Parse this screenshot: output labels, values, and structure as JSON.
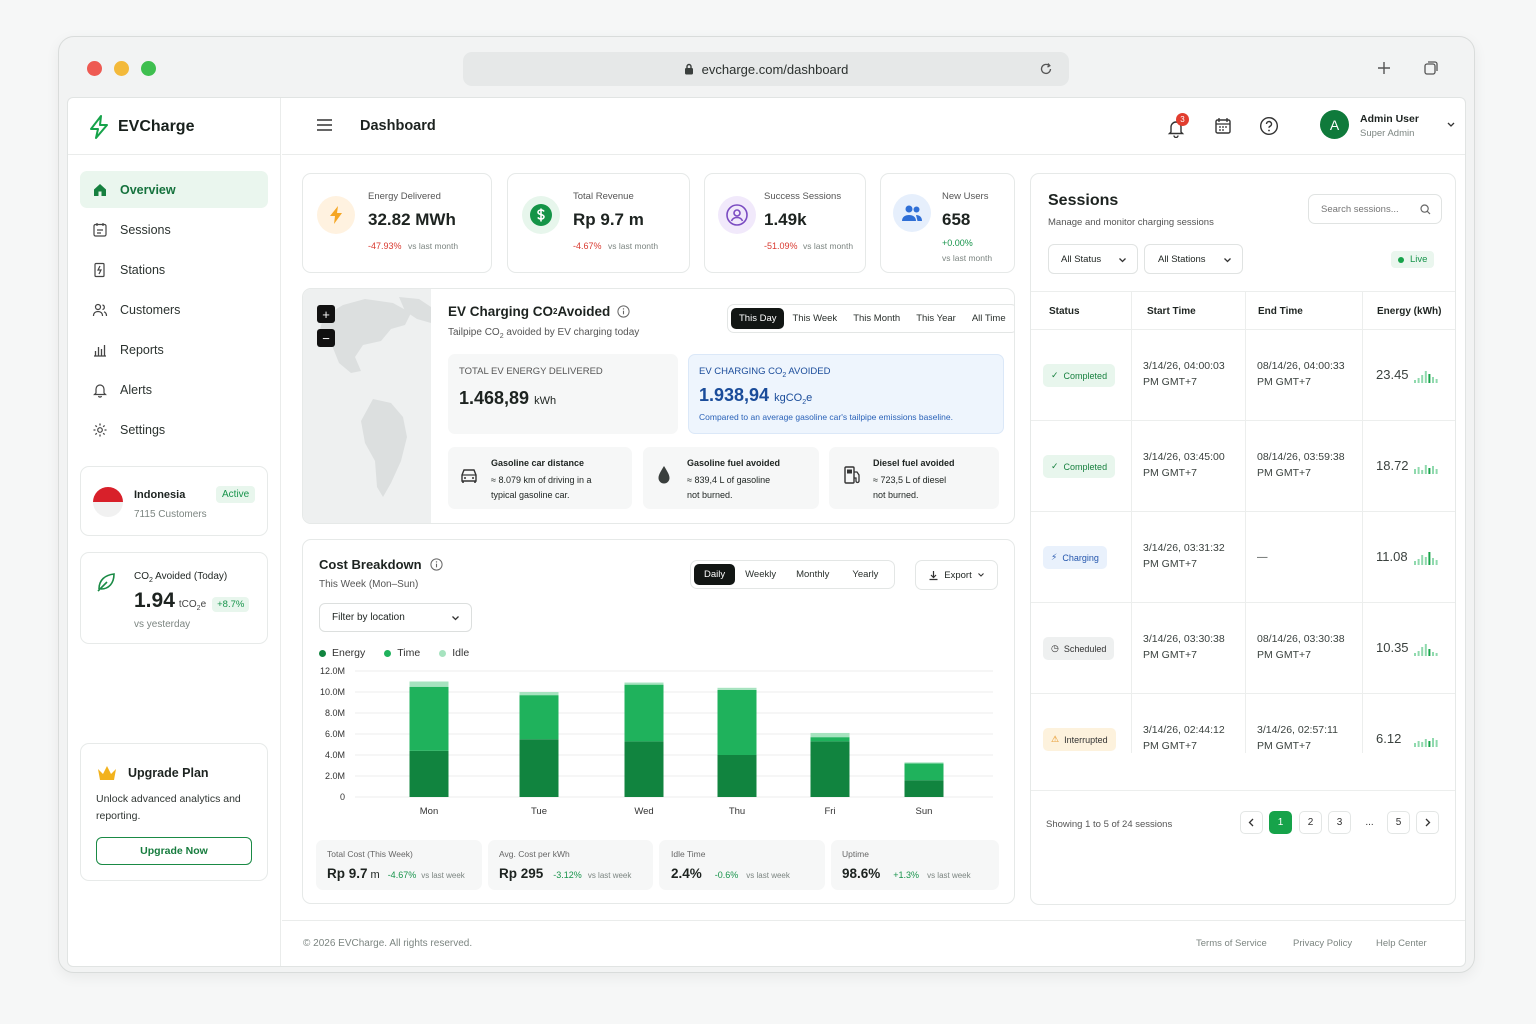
{
  "browser": {
    "url": "evcharge.com/dashboard"
  },
  "brand": {
    "name": "EVCharge"
  },
  "sidebar": {
    "items": [
      {
        "label": "Overview"
      },
      {
        "label": "Sessions"
      },
      {
        "label": "Stations"
      },
      {
        "label": "Customers"
      },
      {
        "label": "Reports"
      },
      {
        "label": "Alerts"
      },
      {
        "label": "Settings"
      }
    ],
    "region": {
      "name": "Indonesia",
      "status": "Active",
      "customers": "7115 Customers"
    },
    "co2": {
      "label_prefix": "CO",
      "label_sub": "2",
      "label_suffix": " Avoided (Today)",
      "value": "1.94",
      "unit": "tCO",
      "unit_sub": "2",
      "unit_suffix": "e",
      "change": "+8.7%",
      "compare": "vs yesterday"
    },
    "upgrade": {
      "title": "Upgrade Plan",
      "desc": "Unlock advanced analytics and reporting.",
      "button": "Upgrade Now"
    }
  },
  "topbar": {
    "title": "Dashboard",
    "notifications": "3",
    "user": {
      "initial": "A",
      "name": "Admin User",
      "role": "Super Admin"
    }
  },
  "kpis": [
    {
      "label": "Energy Delivered",
      "value": "32.82 MWh",
      "change": "-47.93%",
      "compare": "vs last month"
    },
    {
      "label": "Total Revenue",
      "value": "Rp 9.7 m",
      "change": "-4.67%",
      "compare": "vs last month"
    },
    {
      "label": "Success Sessions",
      "value": "1.49k",
      "change": "-51.09%",
      "compare": "vs last month"
    },
    {
      "label": "New Users",
      "value": "658",
      "change": "+0.00%",
      "compare": "vs last month"
    }
  ],
  "co2_panel": {
    "title_prefix": "EV Charging CO",
    "title_sub": "2",
    "title_suffix": " Avoided",
    "subtitle_prefix": "Tailpipe CO",
    "subtitle_sub": "2",
    "subtitle_suffix": " avoided by EV charging today",
    "tabs": [
      "This Day",
      "This Week",
      "This Month",
      "This Year",
      "All Time"
    ],
    "energy": {
      "label": "TOTAL EV ENERGY DELIVERED",
      "value": "1.468,89",
      "unit": "kWh"
    },
    "avoided": {
      "label_prefix": "EV CHARGING CO",
      "label_sub": "2",
      "label_suffix": " AVOIDED",
      "value": "1.938,94",
      "unit": "kgCO",
      "unit_sub": "2",
      "unit_suffix": "e",
      "note": "Compared to an average gasoline car's tailpipe emissions baseline."
    },
    "facts": [
      {
        "title": "Gasoline car distance",
        "line1": "≈ 8.079 km of driving in a",
        "line2": "typical gasoline car."
      },
      {
        "title": "Gasoline fuel avoided",
        "line1": "≈ 839,4 L of gasoline",
        "line2": "not burned."
      },
      {
        "title": "Diesel fuel avoided",
        "line1": "≈ 723,5 L of diesel",
        "line2": "not burned."
      }
    ]
  },
  "cost": {
    "title": "Cost Breakdown",
    "subtitle": "This Week (Mon–Sun)",
    "tabs": [
      "Daily",
      "Weekly",
      "Monthly",
      "Yearly"
    ],
    "export": "Export",
    "filter": "Filter by location",
    "stats": [
      {
        "label": "Total Cost (This Week)",
        "value": "Rp 9.7",
        "unit": "m",
        "change": "-4.67%",
        "compare": "vs last week"
      },
      {
        "label": "Avg. Cost per kWh",
        "value": "Rp 295",
        "unit": "",
        "change": "-3.12%",
        "compare": "vs last week"
      },
      {
        "label": "Idle Time",
        "value": "2.4%",
        "unit": "",
        "change": "-0.6%",
        "compare": "vs last week"
      },
      {
        "label": "Uptime",
        "value": "98.6%",
        "unit": "",
        "change": "+1.3%",
        "compare": "vs last week"
      }
    ]
  },
  "chart_data": {
    "type": "bar",
    "stacked": true,
    "categories": [
      "Mon",
      "Tue",
      "Wed",
      "Thu",
      "Fri",
      "Sun"
    ],
    "series": [
      {
        "name": "Energy",
        "color": "#11843f",
        "values": [
          4.4,
          5.5,
          5.3,
          4.0,
          5.3,
          1.6
        ]
      },
      {
        "name": "Time",
        "color": "#1fb25c",
        "values": [
          6.1,
          4.2,
          5.4,
          6.2,
          0.4,
          1.6
        ]
      },
      {
        "name": "Idle",
        "color": "#a6e3bf",
        "values": [
          0.5,
          0.3,
          0.2,
          0.2,
          0.4,
          0.1
        ]
      }
    ],
    "ylim": [
      0,
      12
    ],
    "yticks": [
      "0",
      "2.0M",
      "4.0M",
      "6.0M",
      "8.0M",
      "10.0M",
      "12.0M"
    ],
    "grid": true,
    "legend": "top-left"
  },
  "sessions": {
    "title": "Sessions",
    "subtitle": "Manage and monitor charging sessions",
    "search_placeholder": "Search sessions...",
    "filters": [
      "All Status",
      "All Stations"
    ],
    "live": "Live",
    "columns": [
      "Status",
      "Start Time",
      "End Time",
      "Energy (kWh)"
    ],
    "rows": [
      {
        "status": "Completed",
        "start1": "3/14/26, 04:00:03",
        "start2": "PM GMT+7",
        "end1": "08/14/26, 04:00:33",
        "end2": "PM GMT+7",
        "energy": "23.45"
      },
      {
        "status": "Completed",
        "start1": "3/14/26, 03:45:00",
        "start2": "PM GMT+7",
        "end1": "08/14/26, 03:59:38",
        "end2": "PM GMT+7",
        "energy": "18.72"
      },
      {
        "status": "Charging",
        "start1": "3/14/26, 03:31:32",
        "start2": "PM GMT+7",
        "end1": "—",
        "end2": "",
        "energy": "11.08"
      },
      {
        "status": "Scheduled",
        "start1": "3/14/26, 03:30:38",
        "start2": "PM GMT+7",
        "end1": "08/14/26, 03:30:38",
        "end2": "PM GMT+7",
        "energy": "10.35"
      },
      {
        "status": "Interrupted",
        "start1": "3/14/26, 02:44:12",
        "start2": "PM GMT+7",
        "end1": "3/14/26, 02:57:11",
        "end2": "PM GMT+7",
        "energy": "6.12"
      }
    ],
    "showing": "Showing 1 to 5 of 24 sessions",
    "pages": [
      "1",
      "2",
      "3",
      "...",
      "5"
    ]
  },
  "footer": {
    "copyright": "© 2026 EVCharge. All rights reserved.",
    "links": [
      "Terms of Service",
      "Privacy Policy",
      "Help Center"
    ]
  }
}
